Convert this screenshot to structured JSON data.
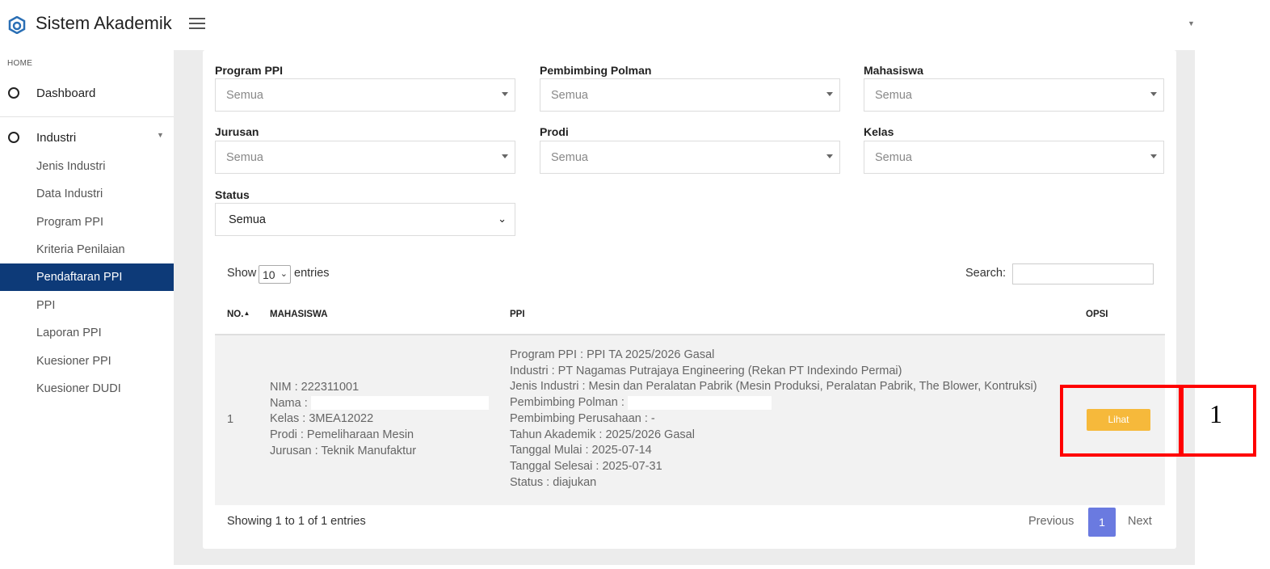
{
  "app": {
    "title": "Sistem Akademik"
  },
  "sidebar": {
    "header": "HOME",
    "main_items": [
      {
        "label": "Dashboard"
      },
      {
        "label": "Industri"
      }
    ],
    "sub_items": [
      {
        "label": "Jenis Industri"
      },
      {
        "label": "Data Industri"
      },
      {
        "label": "Program PPI"
      },
      {
        "label": "Kriteria Penilaian"
      },
      {
        "label": "Pendaftaran PPI",
        "active": true
      },
      {
        "label": "PPI"
      },
      {
        "label": "Laporan PPI"
      },
      {
        "label": "Kuesioner PPI"
      },
      {
        "label": "Kuesioner DUDI"
      }
    ]
  },
  "filters": [
    {
      "label": "Program PPI",
      "value": "Semua"
    },
    {
      "label": "Pembimbing Polman",
      "value": "Semua"
    },
    {
      "label": "Mahasiswa",
      "value": "Semua"
    },
    {
      "label": "Jurusan",
      "value": "Semua"
    },
    {
      "label": "Prodi",
      "value": "Semua"
    },
    {
      "label": "Kelas",
      "value": "Semua"
    },
    {
      "label": "Status",
      "value": "Semua"
    }
  ],
  "table_controls": {
    "show_label": "Show",
    "page_length": "10",
    "entries_label": "entries",
    "search_label": "Search:",
    "search_value": ""
  },
  "table": {
    "headers": [
      "NO.",
      "MAHASISWA",
      "PPI",
      "OPSI"
    ],
    "rows": [
      {
        "no": "1",
        "mahasiswa": {
          "nim": "NIM : 222311001",
          "nama": "Nama :",
          "kelas": "Kelas : 3MEA12022",
          "prodi": "Prodi : Pemeliharaan Mesin",
          "jurusan": "Jurusan : Teknik Manufaktur"
        },
        "ppi": {
          "program": "Program PPI : PPI TA 2025/2026 Gasal",
          "industri": "Industri : PT Nagamas Putrajaya Engineering (Rekan PT Indexindo Permai)",
          "jenis": "Jenis Industri : Mesin dan Peralatan Pabrik (Mesin Produksi, Peralatan Pabrik, The Blower, Kontruksi)",
          "pembimbing_polman": "Pembimbing Polman :",
          "pembimbing_perusahaan": "Pembimbing Perusahaan : -",
          "tahun": "Tahun Akademik : 2025/2026 Gasal",
          "mulai": "Tanggal Mulai : 2025-07-14",
          "selesai": "Tanggal Selesai : 2025-07-31",
          "status": "Status : diajukan"
        },
        "action_label": "Lihat"
      }
    ]
  },
  "footer": {
    "info": "Showing 1 to 1 of 1 entries",
    "prev": "Previous",
    "current_page": "1",
    "next": "Next"
  },
  "annotation": {
    "label": "1",
    "color": "#ff0000"
  },
  "colors": {
    "sidebar_active": "#0d3a78",
    "button_warning": "#f6b93b",
    "pagination_active": "#6a7ae0"
  }
}
